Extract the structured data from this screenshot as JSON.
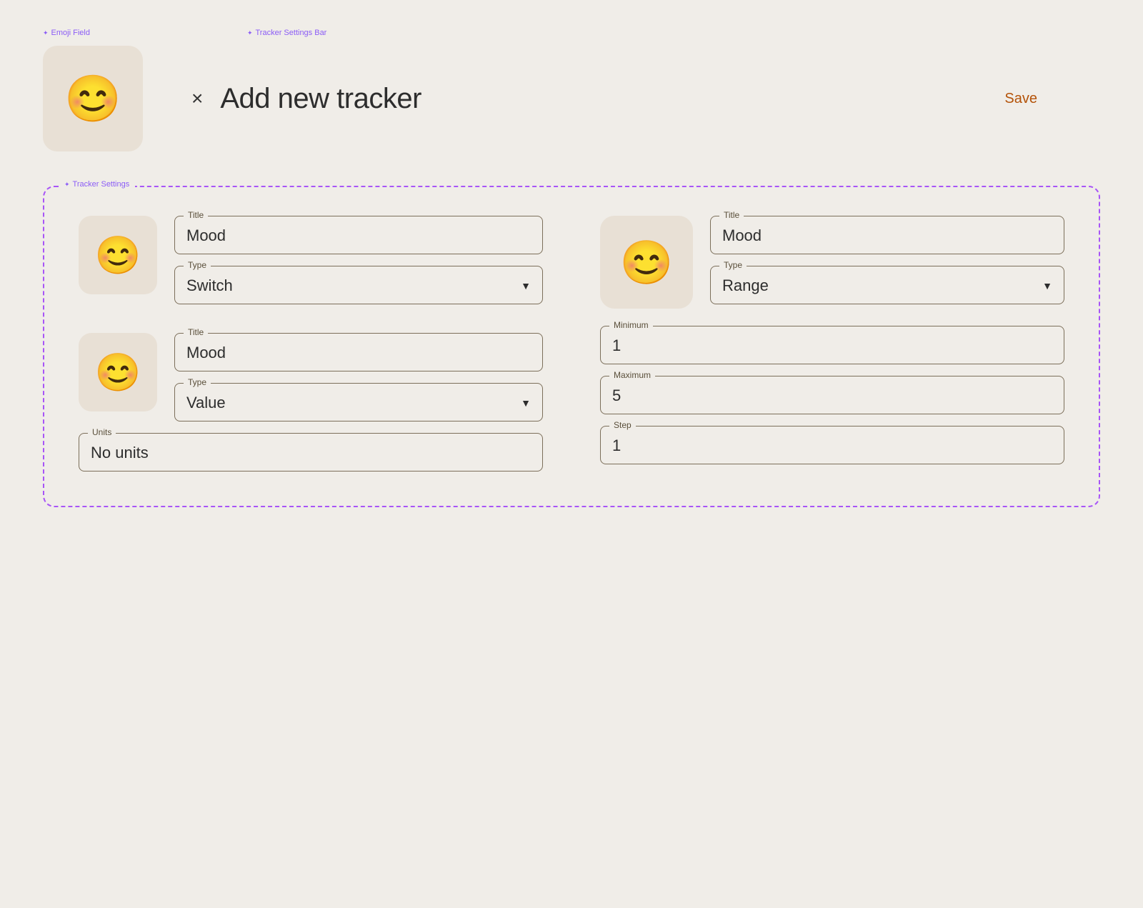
{
  "components": {
    "emoji_field_label": "Emoji Field",
    "tracker_settings_bar_label": "Tracker Settings Bar",
    "tracker_settings_label": "Tracker Settings"
  },
  "header": {
    "close_icon": "×",
    "title": "Add new tracker",
    "save_label": "Save"
  },
  "emoji": "😊",
  "tracker1": {
    "title_label": "Title",
    "title_value": "Mood",
    "type_label": "Type",
    "type_value": "Switch"
  },
  "tracker2": {
    "title_label": "Title",
    "title_value": "Mood",
    "type_label": "Type",
    "type_value": "Value",
    "units_label": "Units",
    "units_value": "No units"
  },
  "tracker3": {
    "title_label": "Title",
    "title_value": "Mood",
    "type_label": "Type",
    "type_value": "Range",
    "minimum_label": "Minimum",
    "minimum_value": "1",
    "maximum_label": "Maximum",
    "maximum_value": "5",
    "step_label": "Step",
    "step_value": "1"
  }
}
